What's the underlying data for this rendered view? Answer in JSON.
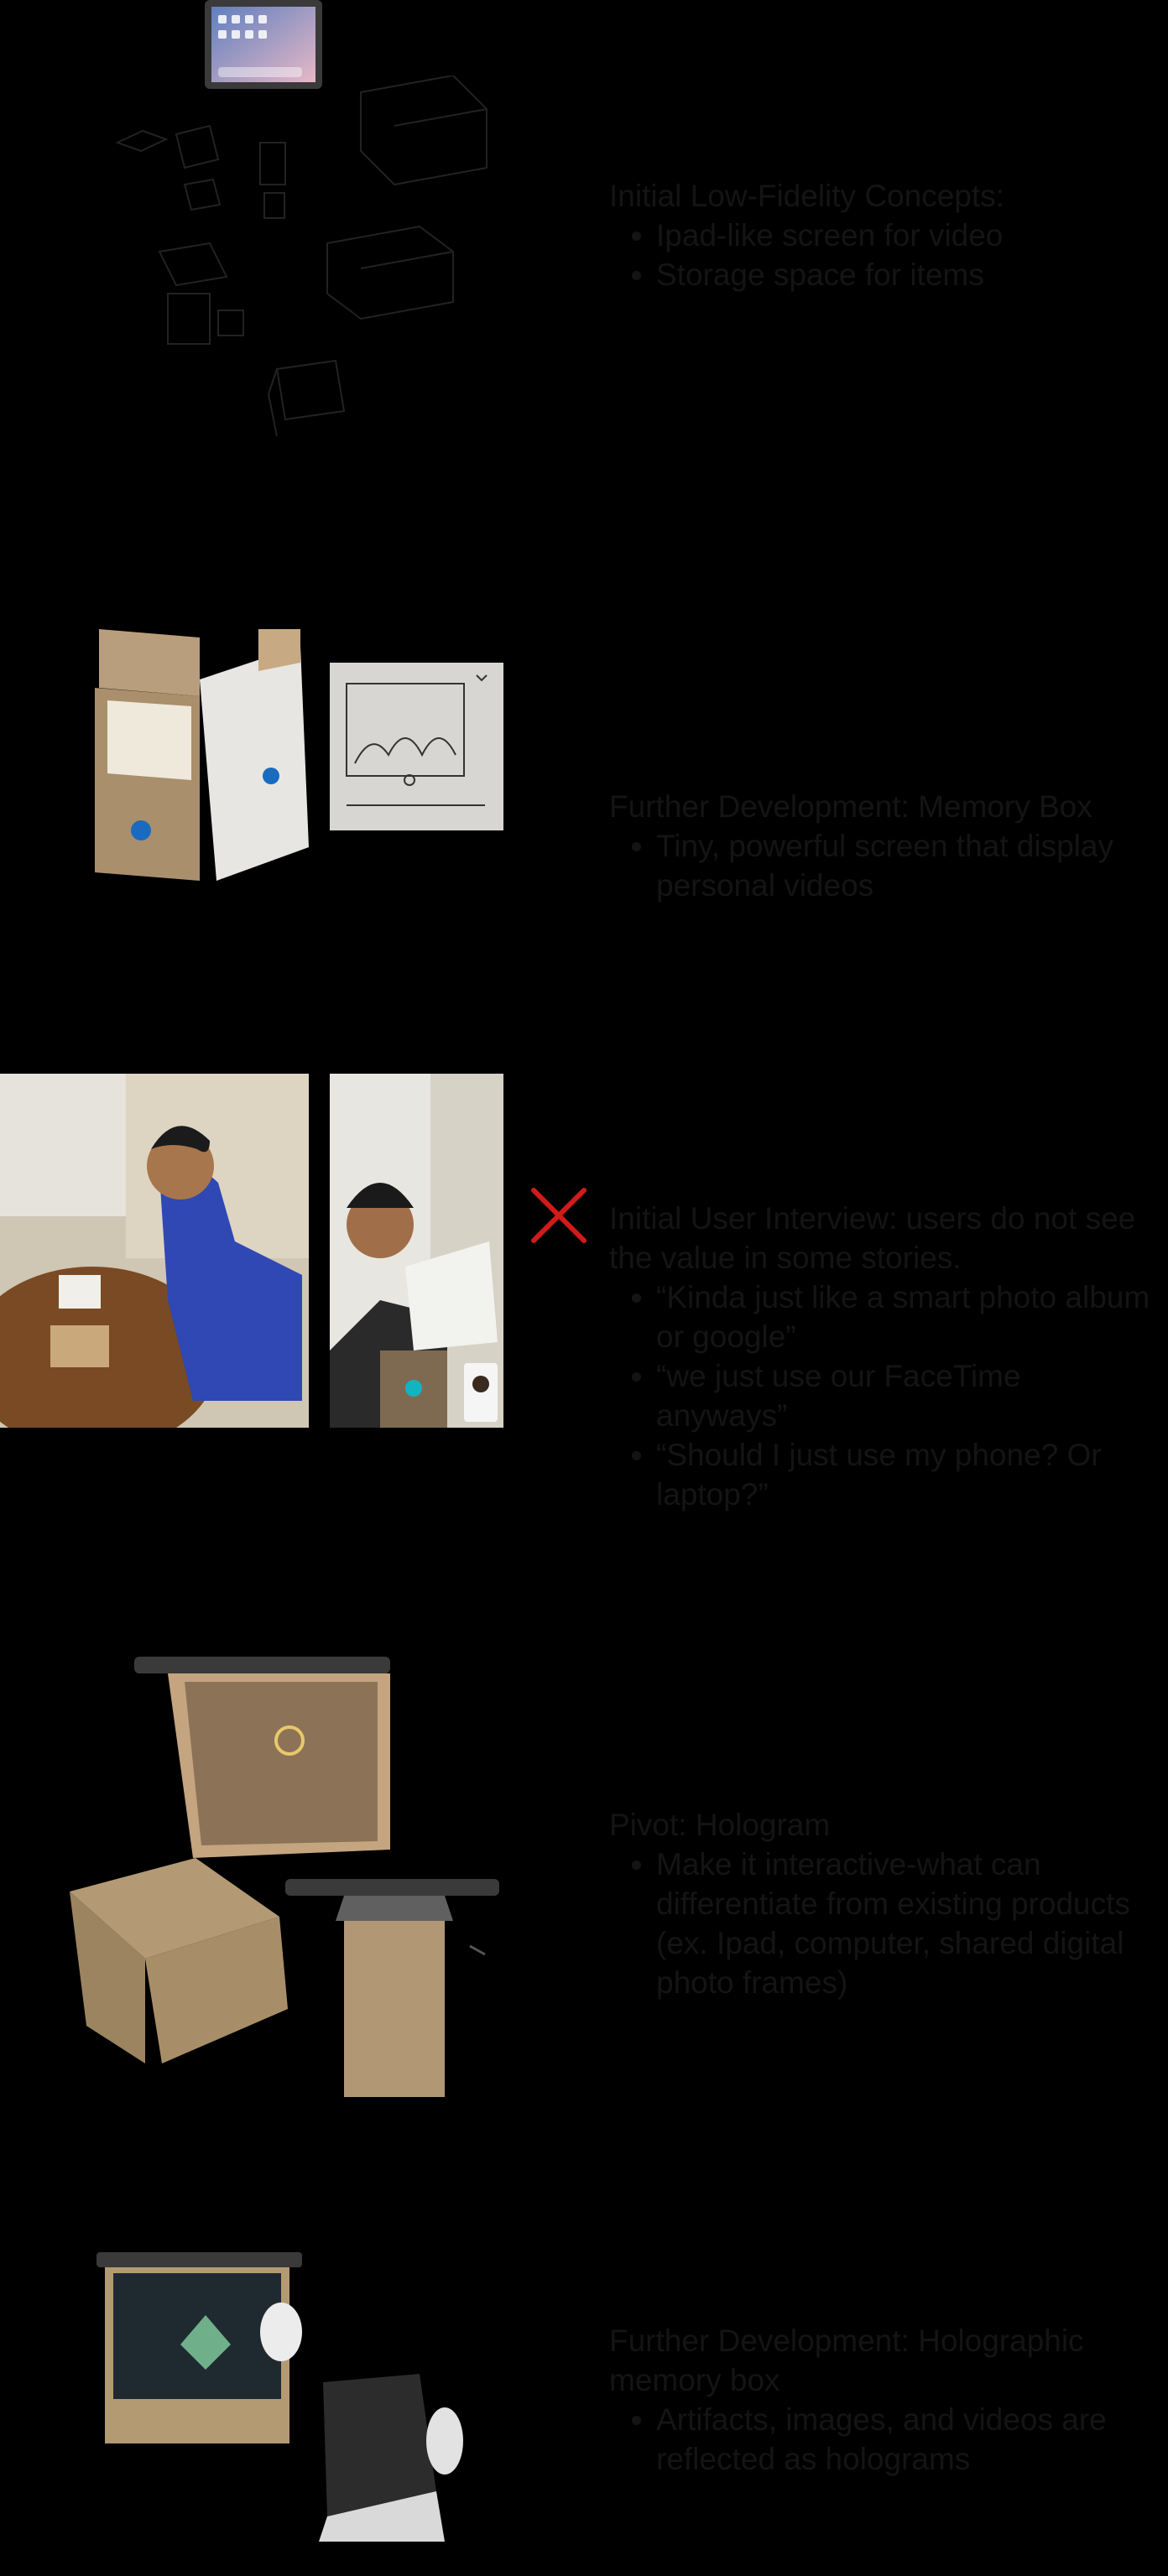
{
  "sections": [
    {
      "heading": "Initial Low-Fidelity Concepts:",
      "bullets": [
        "Ipad-like screen for video",
        "Storage space for items"
      ]
    },
    {
      "heading": "Further Development: Memory Box",
      "bullets": [
        "Tiny, powerful screen that display personal videos"
      ]
    },
    {
      "heading": "Initial User Interview: users do not see the value in some stories.",
      "bullets": [
        "“Kinda just like a smart photo album or google”",
        "“we just use our FaceTime anyways”",
        "“Should I just use my phone? Or laptop?”"
      ]
    },
    {
      "heading": "Pivot: Hologram",
      "bullets": [
        "Make it interactive-what can differentiate from existing products (ex. Ipad, computer, shared digital photo frames)"
      ]
    },
    {
      "heading": "Further Development: Holographic memory box",
      "bullets": [
        "Artifacts, images, and videos are reflected as holograms"
      ]
    }
  ],
  "status_marks": {
    "user_interview_mark": "x-mark",
    "mark_color": "#d11a1a"
  }
}
